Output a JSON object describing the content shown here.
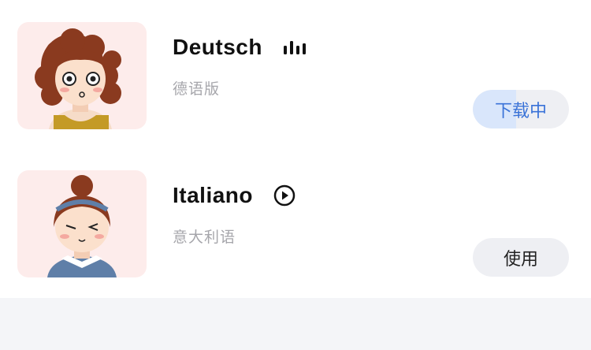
{
  "languages": [
    {
      "name": "Deutsch",
      "subtitle": "德语版",
      "status_icon": "audio-bars-icon",
      "action_label": "下载中",
      "download_progress": 0.45,
      "avatar": "woman-curly-hair-avatar"
    },
    {
      "name": "Italiano",
      "subtitle": "意大利语",
      "status_icon": "play-circle-icon",
      "action_label": "使用",
      "avatar": "woman-hair-bun-avatar"
    }
  ],
  "colors": {
    "accent": "#3a73d8",
    "progress_fill": "#d9e6fb",
    "button_bg": "#eeeff3",
    "avatar_bg": "#fdeceb",
    "footer_bg": "#f4f5f8"
  }
}
